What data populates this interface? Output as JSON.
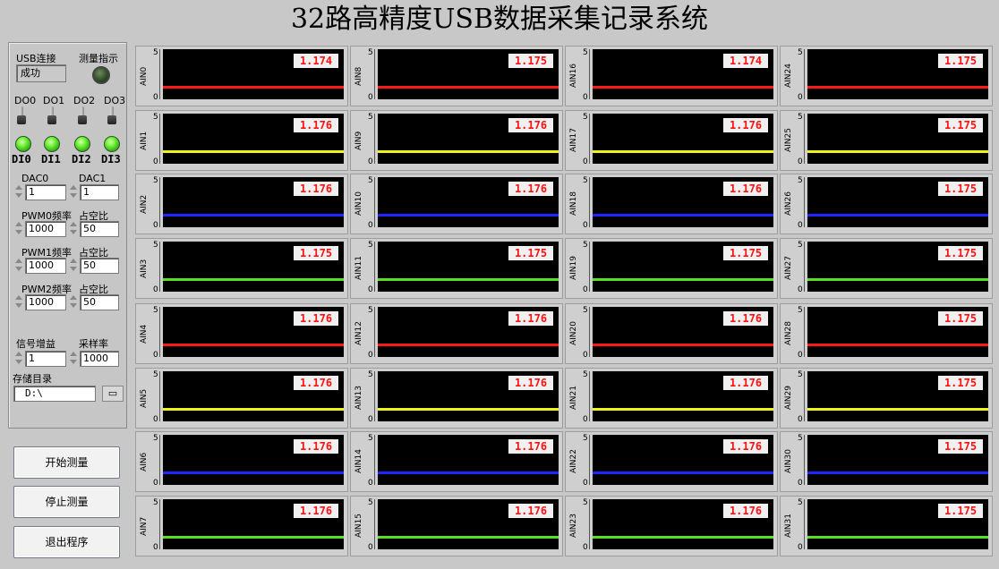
{
  "title": "32路高精度USB数据采集记录系统",
  "controls": {
    "usb_label": "USB连接",
    "usb_status": "成功",
    "indicator_label": "测量指示",
    "do_labels": [
      "DO0",
      "DO1",
      "DO2",
      "DO3"
    ],
    "di_labels": [
      "DI0",
      "DI1",
      "DI2",
      "DI3"
    ],
    "dac0_label": "DAC0",
    "dac0_value": "1",
    "dac1_label": "DAC1",
    "dac1_value": "1",
    "pwm0_label": "PWM0频率",
    "pwm0_value": "1000",
    "pwm1_label": "PWM1频率",
    "pwm1_value": "1000",
    "pwm2_label": "PWM2频率",
    "pwm2_value": "1000",
    "duty_label": "占空比",
    "duty0_value": "50",
    "duty1_value": "50",
    "duty2_value": "50",
    "gain_label": "信号增益",
    "gain_value": "1",
    "rate_label": "采样率",
    "rate_value": "1000",
    "dir_label": "存储目录",
    "dir_value": "D:\\"
  },
  "buttons": {
    "start": "开始测量",
    "stop": "停止测量",
    "exit": "退出程序"
  },
  "axis": {
    "max": "5",
    "min": "0"
  },
  "colors": {
    "red": "#ff1a1a",
    "yellow": "#f0f020",
    "blue": "#1a2aff",
    "green": "#58e020"
  },
  "channels": [
    {
      "name": "AIN0",
      "value": "1.174",
      "color": "red"
    },
    {
      "name": "AIN1",
      "value": "1.176",
      "color": "yellow"
    },
    {
      "name": "AIN2",
      "value": "1.176",
      "color": "blue"
    },
    {
      "name": "AIN3",
      "value": "1.175",
      "color": "green"
    },
    {
      "name": "AIN4",
      "value": "1.176",
      "color": "red"
    },
    {
      "name": "AIN5",
      "value": "1.176",
      "color": "yellow"
    },
    {
      "name": "AIN6",
      "value": "1.176",
      "color": "blue"
    },
    {
      "name": "AIN7",
      "value": "1.176",
      "color": "green"
    },
    {
      "name": "AIN8",
      "value": "1.175",
      "color": "red"
    },
    {
      "name": "AIN9",
      "value": "1.176",
      "color": "yellow"
    },
    {
      "name": "AIN10",
      "value": "1.176",
      "color": "blue"
    },
    {
      "name": "AIN11",
      "value": "1.175",
      "color": "green"
    },
    {
      "name": "AIN12",
      "value": "1.176",
      "color": "red"
    },
    {
      "name": "AIN13",
      "value": "1.176",
      "color": "yellow"
    },
    {
      "name": "AIN14",
      "value": "1.176",
      "color": "blue"
    },
    {
      "name": "AIN15",
      "value": "1.176",
      "color": "green"
    },
    {
      "name": "AIN16",
      "value": "1.174",
      "color": "red"
    },
    {
      "name": "AIN17",
      "value": "1.176",
      "color": "yellow"
    },
    {
      "name": "AIN18",
      "value": "1.176",
      "color": "blue"
    },
    {
      "name": "AIN19",
      "value": "1.175",
      "color": "green"
    },
    {
      "name": "AIN20",
      "value": "1.176",
      "color": "red"
    },
    {
      "name": "AIN21",
      "value": "1.176",
      "color": "yellow"
    },
    {
      "name": "AIN22",
      "value": "1.176",
      "color": "blue"
    },
    {
      "name": "AIN23",
      "value": "1.176",
      "color": "green"
    },
    {
      "name": "AIN24",
      "value": "1.175",
      "color": "red"
    },
    {
      "name": "AIN25",
      "value": "1.175",
      "color": "yellow"
    },
    {
      "name": "AIN26",
      "value": "1.175",
      "color": "blue"
    },
    {
      "name": "AIN27",
      "value": "1.175",
      "color": "green"
    },
    {
      "name": "AIN28",
      "value": "1.175",
      "color": "red"
    },
    {
      "name": "AIN29",
      "value": "1.175",
      "color": "yellow"
    },
    {
      "name": "AIN30",
      "value": "1.175",
      "color": "blue"
    },
    {
      "name": "AIN31",
      "value": "1.175",
      "color": "green"
    }
  ]
}
